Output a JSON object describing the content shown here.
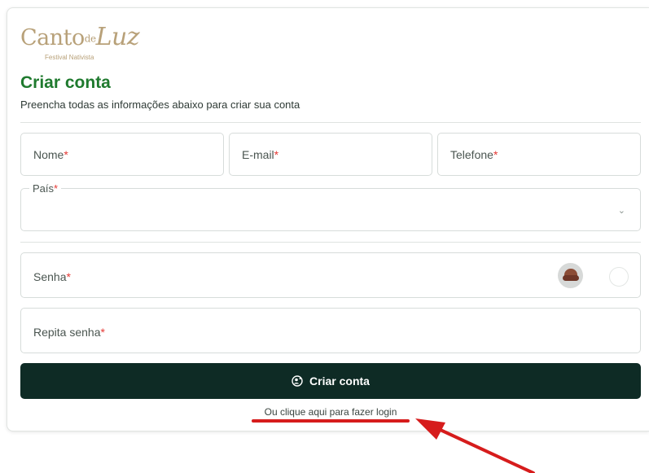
{
  "brand": {
    "logo_main": "Canto",
    "logo_de": "de",
    "logo_luz": "Luz",
    "logo_sub": "Festival Nativista",
    "color": "#b8a179"
  },
  "header": {
    "title": "Criar conta",
    "subtitle": "Preencha todas as informações abaixo para criar sua conta"
  },
  "form": {
    "name_label": "Nome",
    "email_label": "E-mail",
    "phone_label": "Telefone",
    "country_label": "País",
    "country_value": "",
    "password_label": "Senha",
    "repeat_password_label": "Repita senha",
    "required_mark": "*"
  },
  "actions": {
    "submit_label": "Criar conta",
    "login_link": "Ou clique aqui para fazer login"
  },
  "colors": {
    "title": "#1f7a2e",
    "button_bg": "#0e2b25",
    "required": "#e53935",
    "annotation": "#d61c1c"
  },
  "icons": {
    "password_visibility": "see-no-evil-monkey-icon",
    "button": "user-add-icon",
    "select": "chevron-down-icon"
  }
}
